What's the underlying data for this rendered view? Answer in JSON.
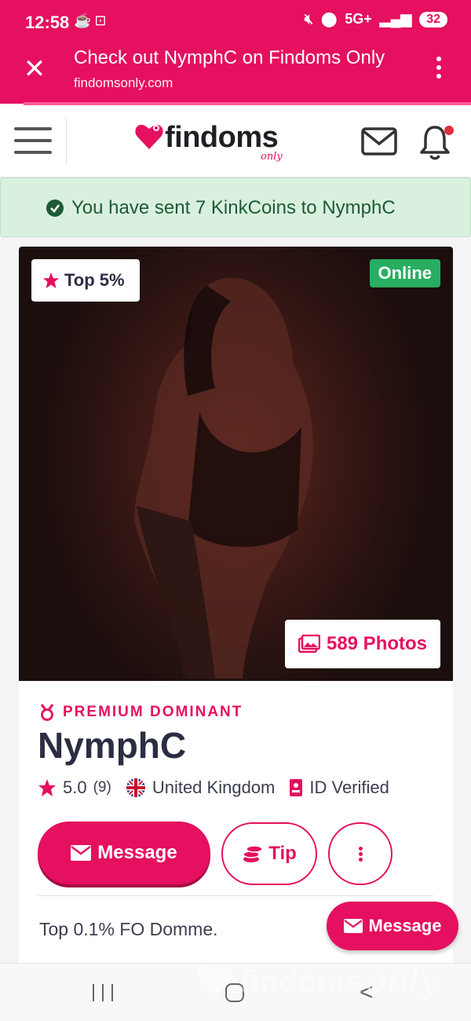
{
  "status_bar": {
    "time": "12:58",
    "network": "5G+",
    "battery": "32",
    "icons": [
      "notification-icon",
      "screenshot-icon",
      "mute-icon",
      "location-icon",
      "signal-icon"
    ]
  },
  "custom_tab": {
    "title": "Check out NymphC on Findoms Only",
    "url": "findomsonly.com"
  },
  "site_header": {
    "logo_text": "findoms",
    "logo_sub": "only"
  },
  "alert": {
    "message": "You have sent 7 KinkCoins to NymphC"
  },
  "profile": {
    "top_badge": "Top 5%",
    "online_badge": "Online",
    "photos_count": "589 Photos",
    "tier": "PREMIUM DOMINANT",
    "name": "NymphC",
    "rating": "5.0",
    "rating_count": "(9)",
    "country": "United Kingdom",
    "verification": "ID Verified",
    "bio": "Top 0.1% FO Domme."
  },
  "actions": {
    "message_label": "Message",
    "tip_label": "Tip",
    "fab_message_label": "Message"
  },
  "watermark": {
    "text": "findoms",
    "sub": "only"
  },
  "colors": {
    "brand": "#e5105f",
    "online": "#27ae60",
    "alert_bg": "#d9f0df",
    "alert_text": "#1e5a36"
  }
}
